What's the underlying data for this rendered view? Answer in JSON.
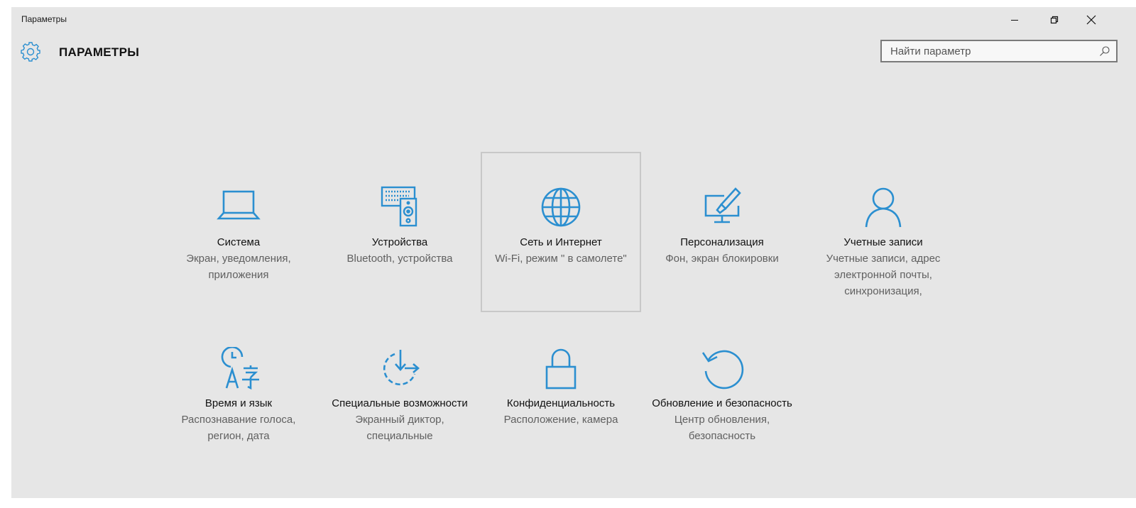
{
  "window": {
    "title": "Параметры"
  },
  "header": {
    "title": "ПАРАМЕТРЫ",
    "search_placeholder": "Найти параметр"
  },
  "tiles": [
    {
      "name": "Система",
      "desc": "Экран, уведомления, приложения",
      "icon": "laptop-icon"
    },
    {
      "name": "Устройства",
      "desc": "Bluetooth, устройства",
      "icon": "devices-icon"
    },
    {
      "name": "Сеть и Интернет",
      "desc": "Wi-Fi, режим \" в самолете\"",
      "icon": "globe-icon"
    },
    {
      "name": "Персонализация",
      "desc": "Фон, экран блокировки",
      "icon": "personalization-icon"
    },
    {
      "name": "Учетные записи",
      "desc": "Учетные записи, адрес электронной почты, синхронизация,",
      "icon": "person-icon"
    },
    {
      "name": "Время и язык",
      "desc": "Распознавание голоса, регион, дата",
      "icon": "time-language-icon"
    },
    {
      "name": "Специальные возможности",
      "desc": "Экранный диктор, специальные",
      "icon": "accessibility-icon"
    },
    {
      "name": "Конфиденциальность",
      "desc": "Расположение, камера",
      "icon": "lock-icon"
    },
    {
      "name": "Обновление и безопасность",
      "desc": "Центр обновления, безопасность",
      "icon": "update-icon"
    }
  ],
  "colors": {
    "accent": "#2b8fd0",
    "background": "#e6e6e6",
    "selection_border": "#c8c8c8"
  }
}
